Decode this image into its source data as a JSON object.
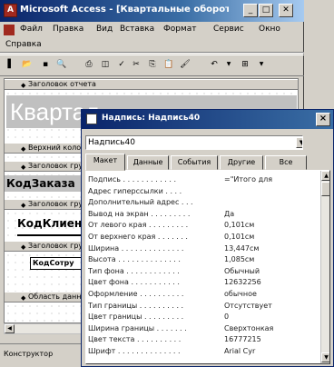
{
  "access": {
    "title": "Microsoft Access - [Квартальные обороты",
    "menu": [
      "Файл",
      "Правка",
      "Вид",
      "Вставка",
      "Формат",
      "Сервис",
      "Окно"
    ],
    "menu2": "Справка",
    "sections": {
      "report_header": "Заголовок отчета",
      "report_title_text": "Квартал",
      "page_header": "Верхний колонтитул",
      "group_header1": "Заголовок группы",
      "field1": "КодЗаказа",
      "group_header2": "Заголовок группы",
      "field2": "КодКлиента",
      "group_header3": "Заголовок группы",
      "field3": "КодСотру",
      "data_area": "Область данных"
    },
    "status": "Конструктор"
  },
  "props": {
    "title": "Надпись: Надпись40",
    "combo_value": "Надпись40",
    "tabs": [
      "Макет",
      "Данные",
      "События",
      "Другие",
      "Все"
    ],
    "rows": [
      {
        "label": "Подпись . . . . . . . . . . . .",
        "value": "=\"Итого для"
      },
      {
        "label": "Адрес гиперссылки . . . .",
        "value": ""
      },
      {
        "label": "Дополнительный адрес . . .",
        "value": ""
      },
      {
        "label": "Вывод на экран . . . . . . . . .",
        "value": "Да"
      },
      {
        "label": "От левого края . . . . . . . . .",
        "value": "0,101см"
      },
      {
        "label": "От верхнего края . . . . . . .",
        "value": "0,101см"
      },
      {
        "label": "Ширина . . . . . . . . . . . . . .",
        "value": "13,447см"
      },
      {
        "label": "Высота . . . . . . . . . . . . . .",
        "value": "1,085см"
      },
      {
        "label": "Тип фона . . . . . . . . . . . .",
        "value": "Обычный"
      },
      {
        "label": "Цвет фона . . . . . . . . . . .",
        "value": "12632256"
      },
      {
        "label": "Оформление . . . . . . . . . .",
        "value": "обычное"
      },
      {
        "label": "Тип границы . . . . . . . . . .",
        "value": "Отсутствует"
      },
      {
        "label": "Цвет границы . . . . . . . . .",
        "value": "0"
      },
      {
        "label": "Ширина границы . . . . . . .",
        "value": "Сверхтонкая"
      },
      {
        "label": "Цвет текста . . . . . . . . . .",
        "value": "16777215"
      },
      {
        "label": "Шрифт . . . . . . . . . . . . . .",
        "value": "Arial Cyr"
      }
    ]
  }
}
